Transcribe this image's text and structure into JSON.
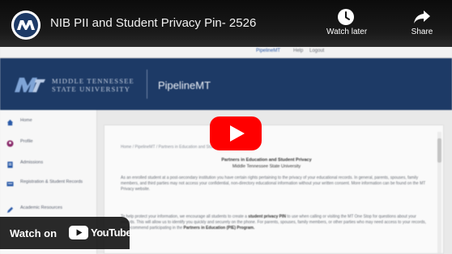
{
  "video": {
    "title": "NIB PII and Student Privacy Pin- 2526",
    "watch_later_label": "Watch later",
    "share_label": "Share",
    "watch_on_label": "Watch on",
    "platform_label": "YouTube",
    "play_label": "Play",
    "channel_avatar_icon": "mtsu-logo-icon"
  },
  "portal": {
    "university_name_line1": "MIDDLE TENNESSEE",
    "university_name_line2": "STATE UNIVERSITY",
    "portal_name": "PipelineMT",
    "utility_links": [
      "PipelineMT",
      "Help",
      "Logout"
    ],
    "breadcrumb": "Home / PipelineMT / Partners in Education and Student Privacy PIN",
    "page_title_line1": "Partners in Education and Student Privacy",
    "page_title_line2": "Middle Tennessee State University",
    "paragraph1": "As an enrolled student at a post-secondary institution you have certain rights pertaining to the privacy of your educational records. In general, parents, spouses, family members, and third parties may not access your confidential, non-directory educational information without your written consent. More information can be found on the MT Privacy website.",
    "paragraph2_start": "To help protect your information, we encourage all students to create a ",
    "paragraph2_bold": "student privacy PIN",
    "paragraph2_end": " to use when calling or visiting the MT One Stop for questions about your records. This will allow us to identify you quickly and securely on the phone. For parents, spouses, family members, or other parties who may need access to your records, we recommend participating in the ",
    "paragraph2_bold2": "Partners in Education (PIE) Program."
  },
  "sidebar": {
    "items": [
      {
        "label": "Home",
        "icon": "home-icon",
        "color": "#2a5aa8"
      },
      {
        "label": "Profile",
        "icon": "profile-icon",
        "color": "#8a2b6b"
      },
      {
        "label": "Admissions",
        "icon": "clipboard-icon",
        "color": "#2a5aa8"
      },
      {
        "label": "Registration & Student Records",
        "icon": "records-icon",
        "color": "#2a5aa8"
      },
      {
        "label": "Academic Resources",
        "icon": "pencil-icon",
        "color": "#2a5aa8"
      }
    ]
  },
  "colors": {
    "banner": "#1d3a66",
    "play_button_red": "#ff0000"
  }
}
